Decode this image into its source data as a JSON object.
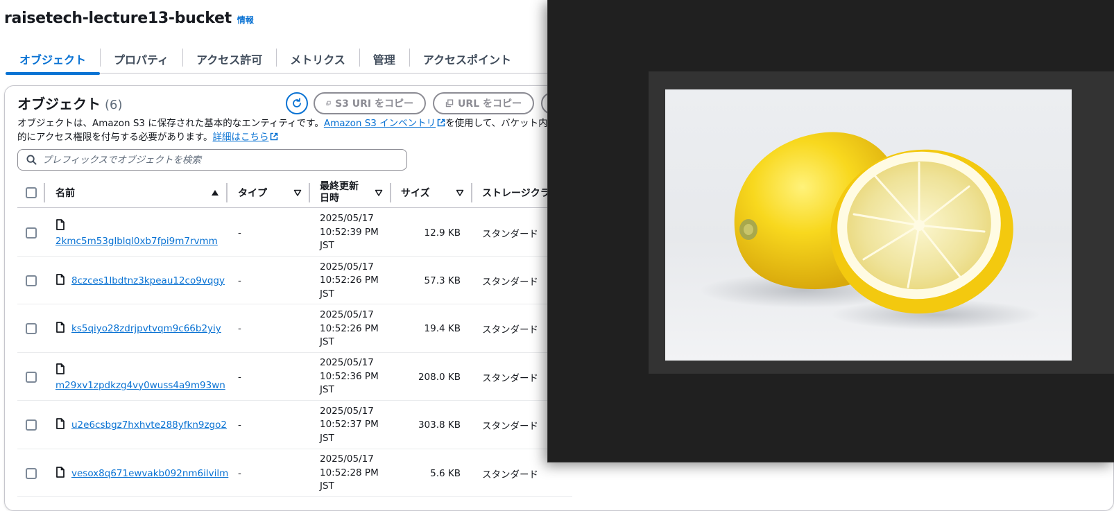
{
  "bucket": {
    "name": "raisetech-lecture13-bucket",
    "info_link": "情報"
  },
  "tabs": [
    {
      "label": "オブジェクト"
    },
    {
      "label": "プロパティ"
    },
    {
      "label": "アクセス許可"
    },
    {
      "label": "メトリクス"
    },
    {
      "label": "管理"
    },
    {
      "label": "アクセスポイント"
    }
  ],
  "objects_panel": {
    "title": "オブジェクト",
    "count": "(6)",
    "buttons": {
      "copy_s3_uri": "S3 URI をコピー",
      "copy_url": "URL をコピー"
    },
    "description": {
      "part1": "オブジェクトは、Amazon S3 に保存された基本的なエンティティです。",
      "inventory_link": "Amazon S3 インベントリ",
      "part2": "を使用して、バケット内",
      "part3": "的にアクセス権限を付与する必要があります。",
      "details_link": "詳細はこちら"
    },
    "search": {
      "placeholder": "プレフィックスでオブジェクトを検索",
      "value": ""
    }
  },
  "table": {
    "columns": {
      "name": "名前",
      "type": "タイプ",
      "modified_line1": "最終更新",
      "modified_line2": "日時",
      "size": "サイズ",
      "storage_class": "ストレージクラ"
    },
    "rows": [
      {
        "name": "2kmc5m53glblql0xb7fpi9m7rvmm",
        "type": "-",
        "date": "2025/05/17",
        "time": "10:52:39 PM",
        "tz": "JST",
        "size": "12.9 KB",
        "storage_class": "スタンダード"
      },
      {
        "name": "8czces1lbdtnz3kpeau12co9vqgy",
        "type": "-",
        "date": "2025/05/17",
        "time": "10:52:26 PM",
        "tz": "JST",
        "size": "57.3 KB",
        "storage_class": "スタンダード"
      },
      {
        "name": "ks5qiyo28zdrjpvtvqm9c66b2yiy",
        "type": "-",
        "date": "2025/05/17",
        "time": "10:52:26 PM",
        "tz": "JST",
        "size": "19.4 KB",
        "storage_class": "スタンダード"
      },
      {
        "name": "m29xv1zpdkzg4vy0wuss4a9m93wn",
        "type": "-",
        "date": "2025/05/17",
        "time": "10:52:36 PM",
        "tz": "JST",
        "size": "208.0 KB",
        "storage_class": "スタンダード"
      },
      {
        "name": "u2e6csbgz7hxhvte288yfkn9zgo2",
        "type": "-",
        "date": "2025/05/17",
        "time": "10:52:37 PM",
        "tz": "JST",
        "size": "303.8 KB",
        "storage_class": "スタンダード"
      },
      {
        "name": "vesox8q671ewvakb092nm6ilvilm",
        "type": "-",
        "date": "2025/05/17",
        "time": "10:52:28 PM",
        "tz": "JST",
        "size": "5.6 KB",
        "storage_class": "スタンダード"
      }
    ]
  },
  "icons": {
    "refresh": "refresh-icon",
    "copy": "copy-icon",
    "external": "external-link-icon",
    "search": "search-icon",
    "file": "file-icon",
    "sort_asc": "sort-ascending-icon",
    "sort": "sort-caret-icon"
  },
  "preview": {
    "subject": "lemon-photo"
  },
  "colors": {
    "link": "#0972d3",
    "active_tab": "#0972d3",
    "text": "#16191f",
    "viewer_bg": "#202020"
  }
}
